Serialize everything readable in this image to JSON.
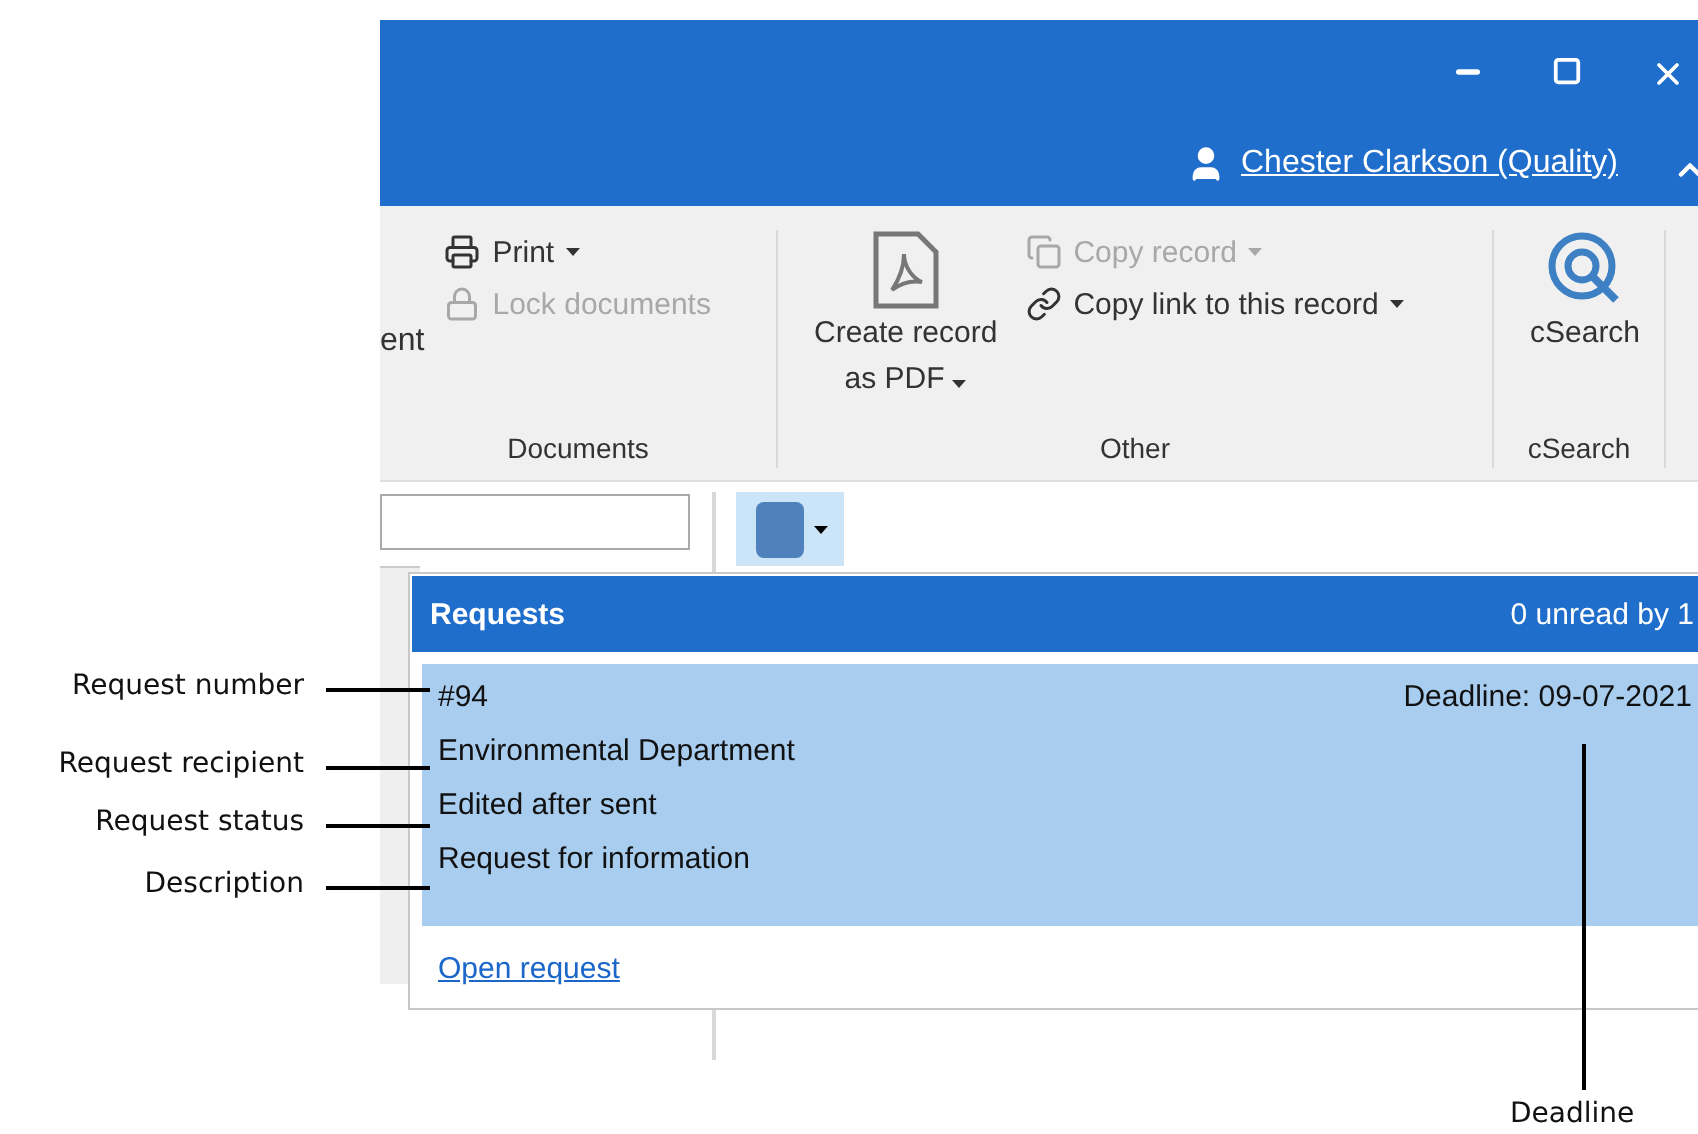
{
  "window": {
    "user": "Chester Clarkson (Quality)"
  },
  "ribbon": {
    "groups": [
      {
        "label": "Documents",
        "items": [
          {
            "kind": "cut",
            "label": "ent"
          },
          {
            "kind": "print",
            "label": "Print",
            "disabled": false,
            "dropdown": true
          },
          {
            "kind": "lock",
            "label": "Lock documents",
            "disabled": true,
            "dropdown": false
          }
        ]
      },
      {
        "label": "Other",
        "items": [
          {
            "kind": "pdf",
            "label": [
              "Create record",
              "as PDF"
            ],
            "disabled": false,
            "dropdown": true
          },
          {
            "kind": "copy",
            "label": "Copy record",
            "disabled": true,
            "dropdown": true
          },
          {
            "kind": "link",
            "label": "Copy link to this record",
            "disabled": false,
            "dropdown": true
          }
        ]
      },
      {
        "label": "cSearch",
        "items": [
          {
            "kind": "search",
            "label": "cSearch",
            "disabled": false,
            "dropdown": false
          }
        ]
      }
    ]
  },
  "requests_popup": {
    "title": "Requests",
    "summary": "0 unread by 1",
    "request": {
      "number": "#94",
      "deadline": "Deadline: 09-07-2021",
      "recipient": "Environmental Department",
      "status": "Edited after sent",
      "description": "Request for information"
    },
    "link": "Open request"
  },
  "callouts": [
    "Request number",
    "Request recipient",
    "Request status",
    "Description",
    "Deadline"
  ]
}
